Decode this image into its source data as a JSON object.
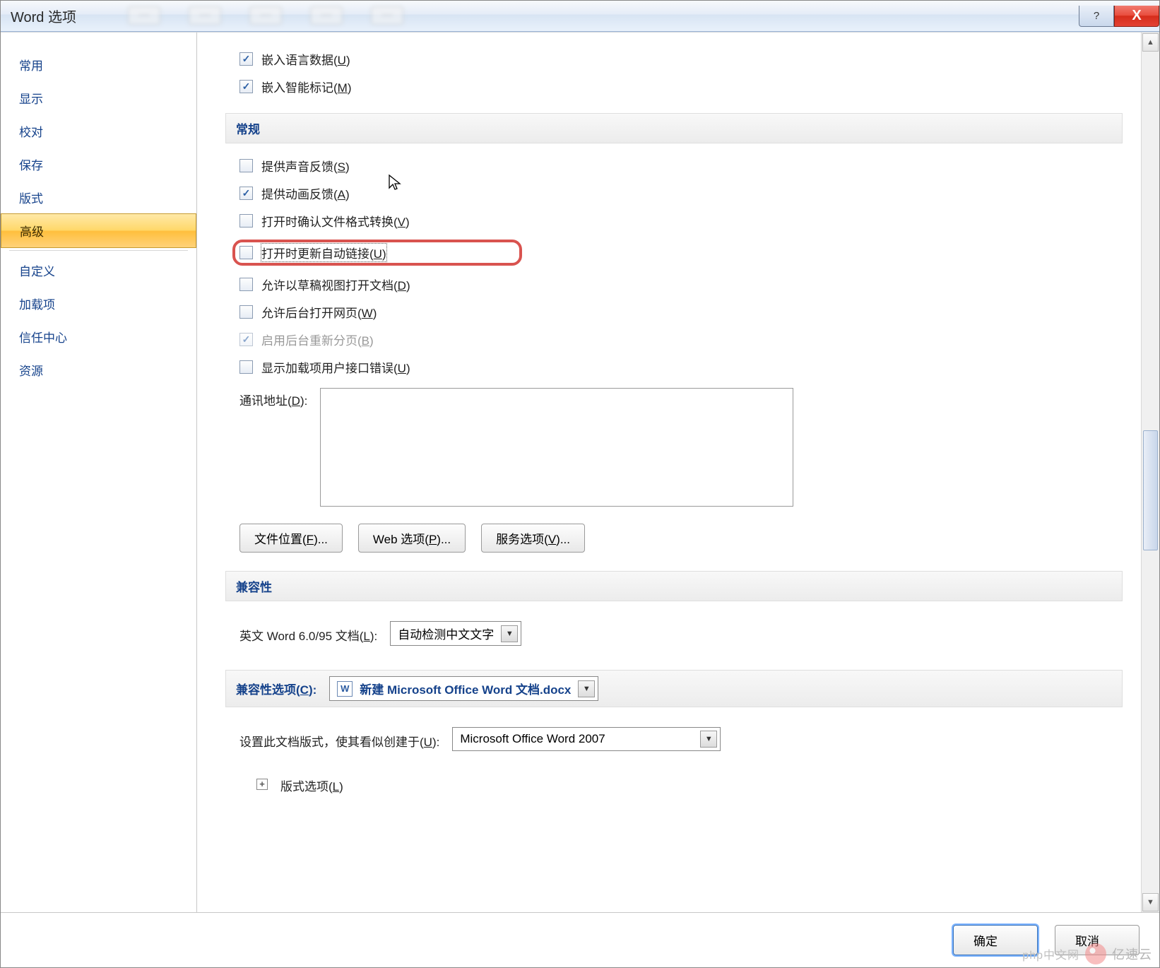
{
  "window": {
    "title": "Word 选项"
  },
  "sidebar": {
    "items": [
      {
        "label": "常用"
      },
      {
        "label": "显示"
      },
      {
        "label": "校对"
      },
      {
        "label": "保存"
      },
      {
        "label": "版式"
      },
      {
        "label": "高级",
        "active": true
      },
      {
        "label": "自定义"
      },
      {
        "label": "加载项"
      },
      {
        "label": "信任中心"
      },
      {
        "label": "资源"
      }
    ]
  },
  "top_checks": {
    "embed_lang_prefix": "嵌入语言数据(",
    "embed_lang_mn": "U",
    "embed_lang_suffix": ")",
    "embed_smart_prefix": "嵌入智能标记(",
    "embed_smart_mn": "M",
    "embed_smart_suffix": ")"
  },
  "general": {
    "heading": "常规",
    "sound_prefix": "提供声音反馈(",
    "sound_mn": "S",
    "sound_suffix": ")",
    "anim_prefix": "提供动画反馈(",
    "anim_mn": "A",
    "anim_suffix": ")",
    "conv_prefix": "打开时确认文件格式转换(",
    "conv_mn": "V",
    "conv_suffix": ")",
    "autolink_prefix": "打开时更新自动链接(",
    "autolink_mn": "U",
    "autolink_suffix": ")",
    "draft_prefix": "允许以草稿视图打开文档(",
    "draft_mn": "D",
    "draft_suffix": ")",
    "bgweb_prefix": "允许后台打开网页(",
    "bgweb_mn": "W",
    "bgweb_suffix": ")",
    "repag_prefix": "启用后台重新分页(",
    "repag_mn": "B",
    "repag_suffix": ")",
    "addin_err_prefix": "显示加载项用户接口错误(",
    "addin_err_mn": "U",
    "addin_err_suffix": ")",
    "mail_label_prefix": "通讯地址(",
    "mail_label_mn": "D",
    "mail_label_suffix": "):",
    "mail_value": "",
    "buttons": {
      "file_loc_prefix": "文件位置(",
      "file_loc_mn": "F",
      "file_loc_suffix": ")...",
      "web_opt_prefix": "Web 选项(",
      "web_opt_mn": "P",
      "web_opt_suffix": ")...",
      "svc_opt_prefix": "服务选项(",
      "svc_opt_mn": "V",
      "svc_opt_suffix": ")..."
    }
  },
  "compat": {
    "heading": "兼容性",
    "eng_doc_prefix": "英文 Word 6.0/95 文档(",
    "eng_doc_mn": "L",
    "eng_doc_suffix": "):",
    "eng_doc_value": "自动检测中文文字",
    "opt_heading_prefix": "兼容性选项(",
    "opt_heading_mn": "C",
    "opt_heading_suffix": "):",
    "doc_name": "新建 Microsoft Office Word 文档.docx",
    "layout_label_prefix": "设置此文档版式，使其看似创建于(",
    "layout_label_mn": "U",
    "layout_label_suffix": "):",
    "layout_value": "Microsoft Office Word 2007",
    "layout_opts_prefix": "版式选项(",
    "layout_opts_mn": "L",
    "layout_opts_suffix": ")"
  },
  "footer": {
    "ok": "确定",
    "cancel": "取消"
  },
  "watermark": {
    "text1": "php中文网",
    "text2": "亿速云"
  }
}
